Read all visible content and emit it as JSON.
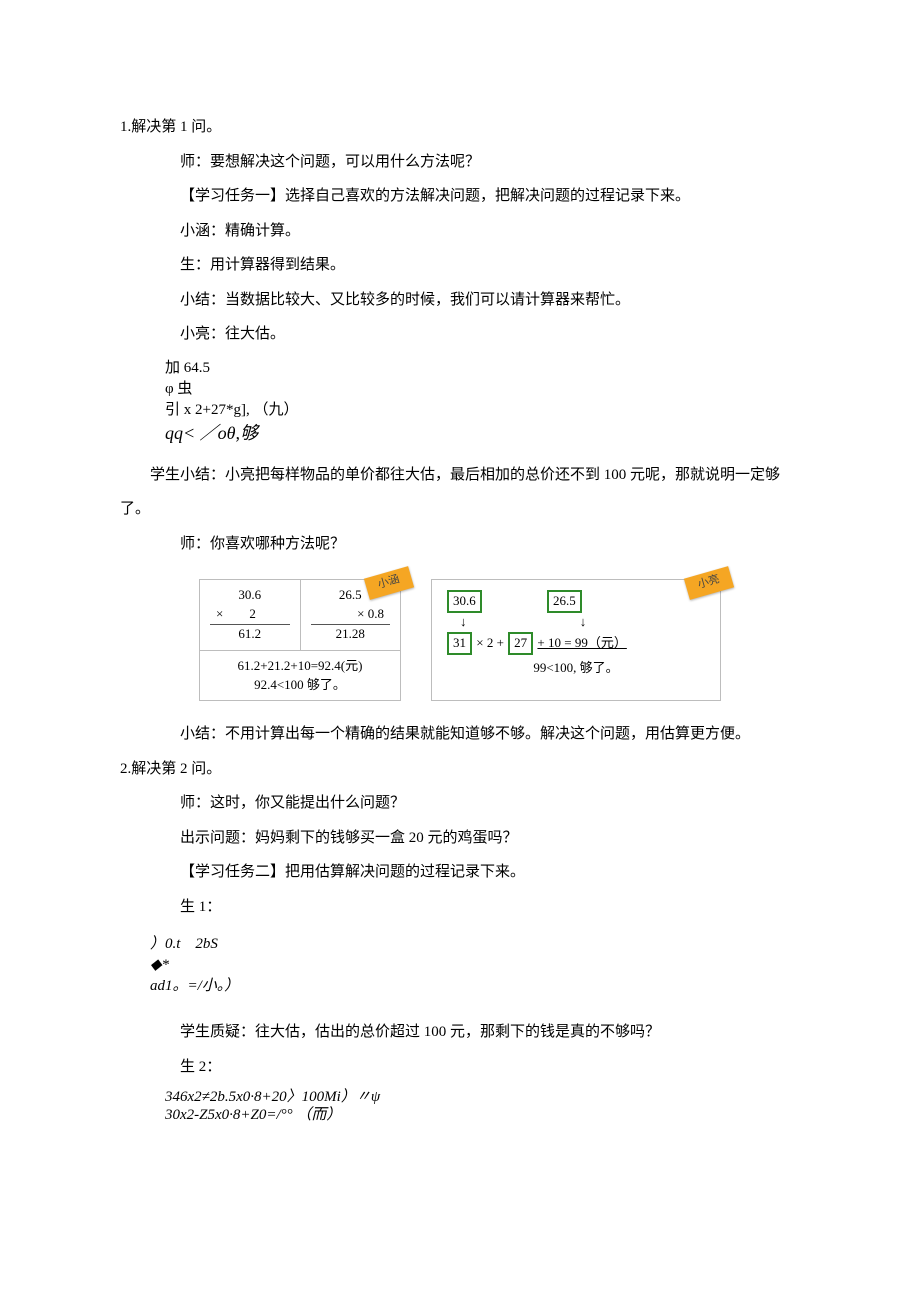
{
  "p0": "1.解决第 1 问。",
  "p1": "师：要想解决这个问题，可以用什么方法呢？",
  "p2": "【学习任务一】选择自己喜欢的方法解决问题，把解决问题的过程记录下来。",
  "p3": "小涵：精确计算。",
  "p4": "生：用计算器得到结果。",
  "p5": "小结：当数据比较大、又比较多的时候，我们可以请计算器来帮忙。",
  "p6": "小亮：往大估。",
  "scratch1_l1": "加 64.5",
  "scratch1_l2": "φ 虫",
  "scratch1_l3": "引 x 2+27*g], （九）",
  "scratch1_l4": "qq< ／oθ,够",
  "p7": "学生小结：小亮把每样物品的单价都往大估，最后相加的总价还不到 100 元呢，那就说明一定够了。",
  "p8": "师：你喜欢哪种方法呢？",
  "card1_tag": "小涵",
  "card1_c1_l1": "30.6",
  "card1_c1_l2": "×　　2",
  "card1_c1_l3": "61.2",
  "card1_c2_l1": "26.5",
  "card1_c2_l2": "× 0.8",
  "card1_c2_l3": "21.28",
  "card1_b1": "61.2+21.2+10=92.4(元)",
  "card1_b2": "92.4<100 够了。",
  "card2_tag": "小亮",
  "card2_a": "30.6",
  "card2_b": "26.5",
  "card2_c": "31",
  "card2_d": "27",
  "card2_eq1": "× 2 +",
  "card2_eq2": "+ 10 = 99（元）",
  "card2_l2": "99<100, 够了。",
  "p9": "小结：不用计算出每一个精确的结果就能知道够不够。解决这个问题，用估算更方便。",
  "p10": "2.解决第 2 问。",
  "p11": "师：这时，你又能提出什么问题？",
  "p12": "出示问题：妈妈剩下的钱够买一盒 20 元的鸡蛋吗？",
  "p13": "【学习任务二】把用估算解决问题的过程记录下来。",
  "p14": "生 1：",
  "scratch2_l1": "）0.t　2bS",
  "scratch2_l2": "◆*",
  "scratch2_l3": "ad1。=/小。）",
  "p15": "学生质疑：往大估，估出的总价超过 100 元，那剩下的钱是真的不够吗？",
  "p16": "生 2：",
  "scratch3_l1": "346x2≠2b.5x0·8+20〉100Mi）〃ψ",
  "scratch3_l2": "30x2-Z5x0·8+Z0=/°° （而）"
}
